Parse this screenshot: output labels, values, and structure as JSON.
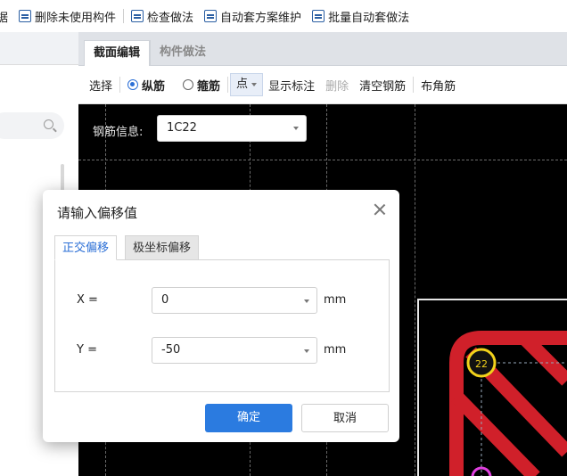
{
  "top_toolbar": {
    "items": [
      {
        "label": "删除未使用构件",
        "icon": "list-icon"
      },
      {
        "label": "检查做法",
        "icon": "check-icon"
      },
      {
        "label": "自动套方案维护",
        "icon": "auto-icon"
      },
      {
        "label": "批量自动套做法",
        "icon": "batch-icon"
      }
    ],
    "cut_off_label": "据"
  },
  "tabs": {
    "active": "截面编辑",
    "inactive": "构件做法"
  },
  "sub_toolbar": {
    "select": "选择",
    "radio_longitudinal": "纵筋",
    "radio_stirrup": "箍筋",
    "point_dropdown": "点",
    "show_annotation": "显示标注",
    "delete": "删除",
    "clear_rebar": "清空钢筋",
    "corner_rebar": "布角筋"
  },
  "canvas": {
    "info_label": "钢筋信息:",
    "info_value": "1C22",
    "rebar_label": "22"
  },
  "dialog": {
    "title": "请输入偏移值",
    "tab_orthogonal": "正交偏移",
    "tab_polar": "极坐标偏移",
    "x_label": "X =",
    "x_value": "0",
    "y_label": "Y =",
    "y_value": "-50",
    "unit_x": "mm",
    "unit_y": "mm",
    "ok": "确定",
    "cancel": "取消"
  },
  "colors": {
    "accent": "#2b7be0",
    "rebar": "#d0202a",
    "highlight": "#f2d21b"
  }
}
